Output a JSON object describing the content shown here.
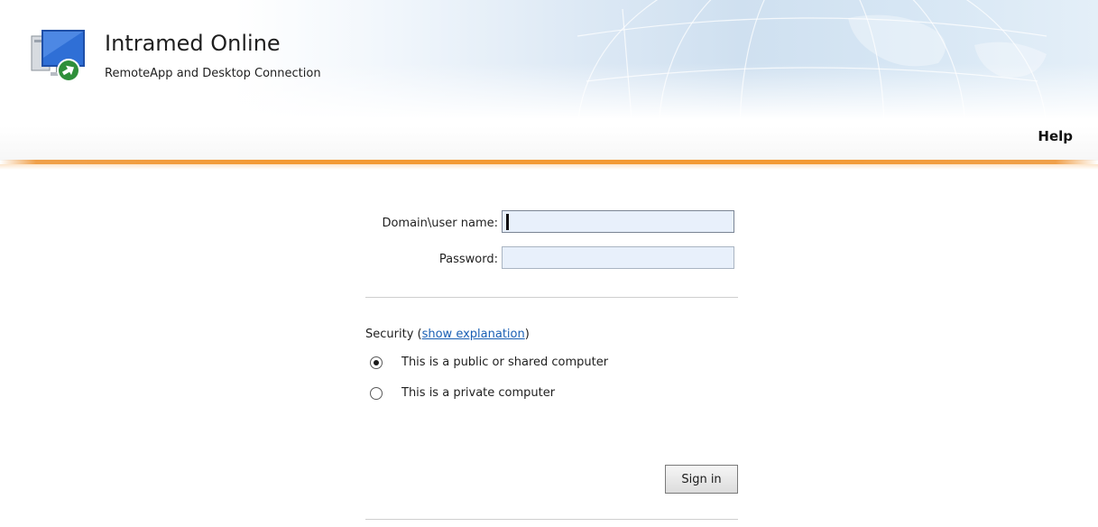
{
  "header": {
    "title": "Intramed Online",
    "subtitle": "RemoteApp and Desktop Connection",
    "logo_icon": "remote-desktop-icon",
    "help_label": "Help"
  },
  "login_form": {
    "username_label": "Domain\\user name:",
    "username_value": "",
    "password_label": "Password:",
    "password_value": "",
    "security": {
      "prefix": "Security (",
      "link_label": "show explanation",
      "suffix": ")",
      "options": [
        {
          "label": "This is a public or shared computer",
          "selected": true
        },
        {
          "label": "This is a private computer",
          "selected": false
        }
      ]
    },
    "sign_in_label": "Sign in"
  },
  "colors": {
    "accent_bar": "#f39a34",
    "link": "#1a5fb4",
    "input_background": "#e8f0fb"
  }
}
